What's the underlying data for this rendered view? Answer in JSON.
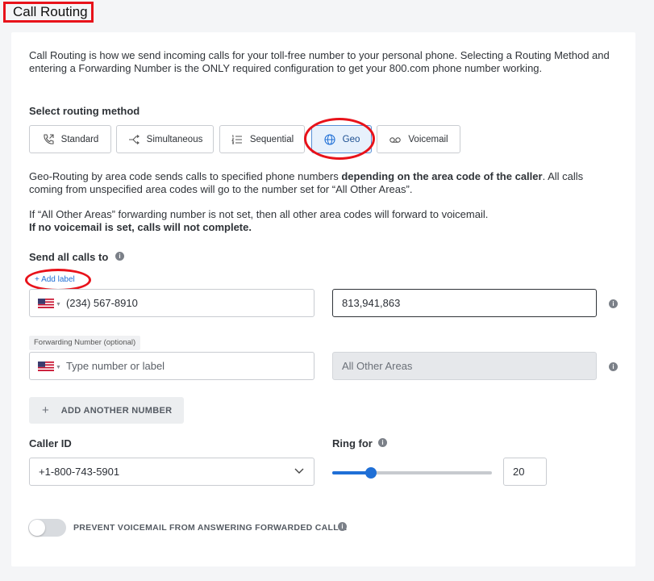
{
  "page": {
    "title": "Call Routing"
  },
  "intro": "Call Routing is how we send incoming calls for your toll-free number to your personal phone. Selecting a Routing Method and entering a Forwarding Number is the ONLY required configuration to get your 800.com phone number working.",
  "routing": {
    "label": "Select routing method",
    "methods": [
      {
        "label": "Standard",
        "icon": "phone-forward-icon"
      },
      {
        "label": "Simultaneous",
        "icon": "split-arrows-icon"
      },
      {
        "label": "Sequential",
        "icon": "numbered-list-icon"
      },
      {
        "label": "Geo",
        "icon": "globe-icon",
        "selected": true
      },
      {
        "label": "Voicemail",
        "icon": "voicemail-icon"
      }
    ]
  },
  "geo": {
    "desc1_a": "Geo-Routing by area code sends calls to specified phone numbers ",
    "desc1_bold": "depending on the area code of the caller",
    "desc1_b": ". All calls coming from unspecified area codes will go to the number set for “All Other Areas”.",
    "desc2": "If “All Other Areas” forwarding number is not set, then all other area codes will forward to voicemail.",
    "desc3": "If no voicemail is set, calls will not complete."
  },
  "send": {
    "label": "Send all calls to",
    "add_label": "+ Add label",
    "row1": {
      "number": "(234) 567-8910",
      "area_codes": "813,941,863"
    },
    "row2": {
      "floating_label": "Forwarding Number (optional)",
      "placeholder": "Type number or label",
      "area_codes": "All Other Areas"
    },
    "add_another": "ADD ANOTHER NUMBER"
  },
  "caller_id": {
    "label": "Caller ID",
    "value": "+1-800-743-5901"
  },
  "ring": {
    "label": "Ring for",
    "value": "20",
    "slider_fraction": 0.24
  },
  "prevent_vm": {
    "label": "PREVENT VOICEMAIL FROM ANSWERING FORWARDED CALLS.",
    "enabled": false
  },
  "colors": {
    "annotation": "#e8121a",
    "accent": "#1f6fd6",
    "selected_bg": "#e7f1fc"
  }
}
